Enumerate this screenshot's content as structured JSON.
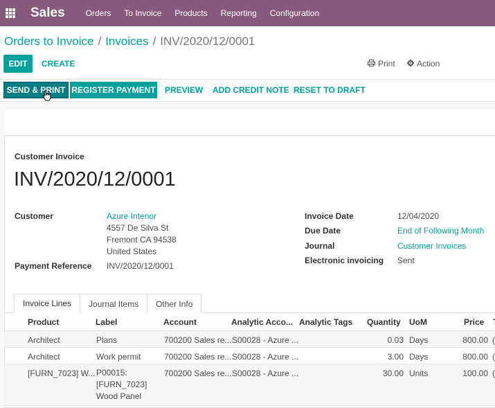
{
  "navbar": {
    "app_name": "Sales",
    "menu": [
      "Orders",
      "To Invoice",
      "Products",
      "Reporting",
      "Configuration"
    ]
  },
  "breadcrumb": {
    "items": [
      "Orders to Invoice",
      "Invoices"
    ],
    "current": "INV/2020/12/0001",
    "separator": "/"
  },
  "control_panel": {
    "edit_label": "EDIT",
    "create_label": "CREATE",
    "print_label": "Print",
    "action_label": "Action"
  },
  "status_buttons": {
    "send_print": "SEND & PRINT",
    "register_payment": "REGISTER PAYMENT",
    "preview": "PREVIEW",
    "add_credit_note": "ADD CREDIT NOTE",
    "reset_to_draft": "RESET TO DRAFT"
  },
  "invoice": {
    "type": "Customer Invoice",
    "number": "INV/2020/12/0001",
    "customer_label": "Customer",
    "customer_name": "Azure Interior",
    "address_line1": "4557 De Silva St",
    "address_line2": "Fremont CA 94538",
    "address_line3": "United States",
    "payment_ref_label": "Payment Reference",
    "payment_ref": "INV/2020/12/0001",
    "invoice_date_label": "Invoice Date",
    "invoice_date": "12/04/2020",
    "due_date_label": "Due Date",
    "due_date": "End of Following Month",
    "journal_label": "Journal",
    "journal": "Customer Invoices",
    "einvoicing_label": "Electronic invoicing",
    "einvoicing": "Sent"
  },
  "tabs": [
    "Invoice Lines",
    "Journal Items",
    "Other Info"
  ],
  "lines": {
    "headers": [
      "Product",
      "Label",
      "Account",
      "Analytic Acco...",
      "Analytic Tags",
      "Quantity",
      "UoM",
      "Price",
      "T"
    ],
    "rows": [
      {
        "product": "Architect",
        "label": "Plans",
        "account": "700200 Sales re...",
        "analytic": "S00028 - Azure ...",
        "tags": "",
        "qty": "0.03",
        "uom": "Days",
        "price": "800.00",
        "tax": "("
      },
      {
        "product": "Architect",
        "label": "Work permit",
        "account": "700200 Sales re...",
        "analytic": "S00028 - Azure ...",
        "tags": "",
        "qty": "3.00",
        "uom": "Days",
        "price": "800.00",
        "tax": "("
      },
      {
        "product": "[FURN_7023] W...",
        "label": "P00015: [FURN_7023] Wood Panel",
        "account": "700200 Sales re...",
        "analytic": "S00028 - Azure ...",
        "tags": "",
        "qty": "30.00",
        "uom": "Units",
        "price": "100.00",
        "tax": "("
      }
    ]
  },
  "colors": {
    "navbar": "#875a7b",
    "primary": "#00a09d",
    "primary_dark": "#017e84"
  }
}
